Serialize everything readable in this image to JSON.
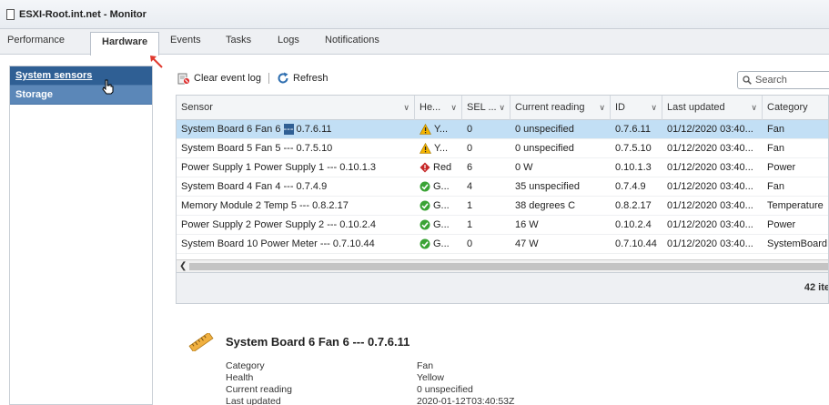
{
  "window": {
    "title": "ESXI-Root.int.net - Monitor"
  },
  "tabs": [
    {
      "label": "Performance"
    },
    {
      "label": "Hardware"
    },
    {
      "label": "Events"
    },
    {
      "label": "Tasks"
    },
    {
      "label": "Logs"
    },
    {
      "label": "Notifications"
    }
  ],
  "sidebar": {
    "items": [
      {
        "label": "System sensors"
      },
      {
        "label": "Storage"
      }
    ]
  },
  "toolbar": {
    "clear_label": "Clear event log",
    "refresh_label": "Refresh"
  },
  "search": {
    "placeholder": "Search"
  },
  "table": {
    "columns": [
      "Sensor",
      "He...",
      "SEL ...",
      "Current reading",
      "ID",
      "Last updated",
      "Category"
    ],
    "rows": [
      {
        "sensor_pre": "System Board 6 Fan 6 ",
        "sensor_hl": "---",
        "sensor_post": " 0.7.6.11",
        "health": "Y...",
        "health_type": "warning",
        "sel": "0",
        "reading": "0 unspecified",
        "id": "0.7.6.11",
        "updated": "01/12/2020 03:40...",
        "category": "Fan"
      },
      {
        "sensor": "System Board 5 Fan 5 --- 0.7.5.10",
        "health": "Y...",
        "health_type": "warning",
        "sel": "0",
        "reading": "0 unspecified",
        "id": "0.7.5.10",
        "updated": "01/12/2020 03:40...",
        "category": "Fan"
      },
      {
        "sensor": "Power Supply 1 Power Supply 1 --- 0.10.1.3",
        "health": "Red",
        "health_type": "error",
        "sel": "6",
        "reading": "0 W",
        "id": "0.10.1.3",
        "updated": "01/12/2020 03:40...",
        "category": "Power"
      },
      {
        "sensor": "System Board 4 Fan 4 --- 0.7.4.9",
        "health": "G...",
        "health_type": "ok",
        "sel": "4",
        "reading": "35 unspecified",
        "id": "0.7.4.9",
        "updated": "01/12/2020 03:40...",
        "category": "Fan"
      },
      {
        "sensor": "Memory Module 2 Temp 5 --- 0.8.2.17",
        "health": "G...",
        "health_type": "ok",
        "sel": "1",
        "reading": "38 degrees C",
        "id": "0.8.2.17",
        "updated": "01/12/2020 03:40...",
        "category": "Temperature"
      },
      {
        "sensor": "Power Supply 2 Power Supply 2 --- 0.10.2.4",
        "health": "G...",
        "health_type": "ok",
        "sel": "1",
        "reading": "16 W",
        "id": "0.10.2.4",
        "updated": "01/12/2020 03:40...",
        "category": "Power"
      },
      {
        "sensor": "System Board 10 Power Meter --- 0.7.10.44",
        "health": "G...",
        "health_type": "ok",
        "sel": "0",
        "reading": "47 W",
        "id": "0.7.10.44",
        "updated": "01/12/2020 03:40...",
        "category": "SystemBoard"
      }
    ],
    "footer_count": "42 ite"
  },
  "detail": {
    "title": "System Board 6 Fan 6 --- 0.7.6.11",
    "fields": [
      {
        "label": "Category",
        "value": "Fan"
      },
      {
        "label": "Health",
        "value": "Yellow"
      },
      {
        "label": "Current reading",
        "value": "0 unspecified"
      },
      {
        "label": "Last updated",
        "value": "2020-01-12T03:40:53Z"
      }
    ]
  },
  "colors": {
    "accent": "#2f5f94",
    "selected_row": "#c2dff5",
    "warning": "#f5b400",
    "error": "#c62828",
    "ok": "#3aa335"
  }
}
